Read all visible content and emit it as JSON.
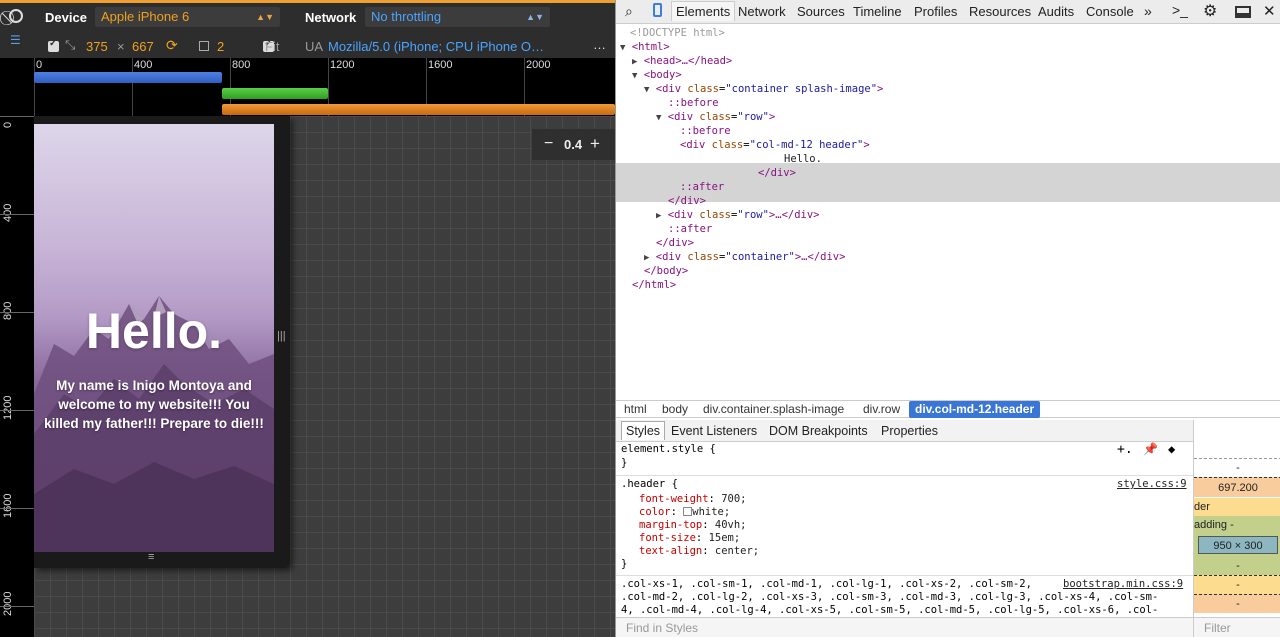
{
  "toolbar": {
    "device_label": "Device",
    "device_value": "Apple iPhone 6",
    "network_label": "Network",
    "network_value": "No throttling",
    "width": "375",
    "times": "×",
    "height": "667",
    "dpr": "2",
    "fit_label": "Fit",
    "ua_label": "UA",
    "ua_value": "Mozilla/5.0 (iPhone; CPU iPhone O…",
    "more": "…"
  },
  "ruler": {
    "top_labels": [
      "0",
      "400",
      "800",
      "1200",
      "1600",
      "2000"
    ],
    "left_labels": [
      "0",
      "400",
      "800",
      "1200",
      "1600",
      "2000"
    ]
  },
  "zoom": {
    "minus": "−",
    "value": "0.4",
    "plus": "+"
  },
  "page": {
    "heading": "Hello.",
    "intro": "My name is Inigo Montoya and welcome to my website!!! You killed my father!!! Prepare to die!!!"
  },
  "devtools": {
    "tabs": [
      "Elements",
      "Network",
      "Sources",
      "Timeline",
      "Profiles",
      "Resources",
      "Audits",
      "Console"
    ],
    "more_tabs": "»",
    "dom": {
      "doctype": "<!DOCTYPE html>",
      "html_open": "<html>",
      "head": "<head>…</head>",
      "body_open": "<body>",
      "container_tag": "div",
      "class_attr": "class",
      "container_class": "\"container splash-image\"",
      "before": "::before",
      "row_class": "\"row\"",
      "header_class": "\"col-md-12 header\"",
      "header_text": "Hello.",
      "div_close": "</div>",
      "after": "::after",
      "row_collapsed_tail": ">…</div>",
      "container2_class": "\"container\"",
      "body_close": "</body>",
      "html_close": "</html>"
    },
    "breadcrumbs": [
      "html",
      "body",
      "div.container.splash-image",
      "div.row",
      "div.col-md-12.header"
    ],
    "style_tabs": [
      "Styles",
      "Event Listeners",
      "DOM Breakpoints",
      "Properties"
    ],
    "styles": {
      "element_style": "element.style {",
      "close_brace": "}",
      "header_selector": ".header {",
      "header_source": "style.css:9",
      "props": [
        {
          "name": "font-weight",
          "value": "700;"
        },
        {
          "name": "color",
          "value": "white;"
        },
        {
          "name": "margin-top",
          "value": "40vh;"
        },
        {
          "name": "font-size",
          "value": "15em;"
        },
        {
          "name": "text-align",
          "value": "center;"
        }
      ],
      "bootstrap_source": "bootstrap.min.css:9",
      "bootstrap_lines": [
        ".col-xs-1, .col-sm-1, .col-md-1, .col-lg-1, .col-xs-2, .col-sm-2,",
        ".col-md-2, .col-lg-2, .col-xs-3, .col-sm-3, .col-md-3, .col-lg-3, .col-xs-4, .col-sm-",
        "4, .col-md-4, .col-lg-4, .col-xs-5, .col-sm-5, .col-md-5, .col-lg-5, .col-xs-6, .col-"
      ],
      "find_placeholder": "Find in Styles"
    },
    "box_model": {
      "dash1": "-",
      "margin_value": "697.200",
      "border_label": "der",
      "padding_label": "adding",
      "padding_dash": "-",
      "content_size": "950 × 300",
      "dash2": "-",
      "dash3": "-",
      "dash4": "-",
      "filter_placeholder": "Filter"
    }
  },
  "colors": {
    "accent_orange": "#f0a020",
    "link_blue": "#4aa3ff",
    "selection_blue": "#3a76d6",
    "margin_orange": "#f9cc9d",
    "border_yellow": "#fcdc8f",
    "padding_green": "#c3d08b",
    "content_blue": "#8cb6c0"
  }
}
